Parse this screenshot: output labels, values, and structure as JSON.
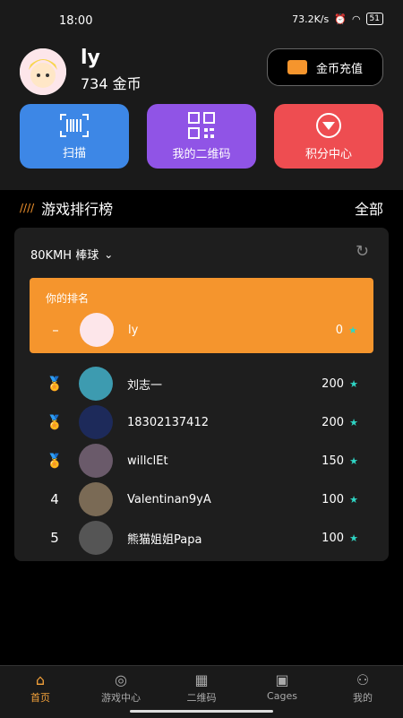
{
  "status": {
    "time": "18:00",
    "speed": "73.2K/s",
    "battery": "51"
  },
  "profile": {
    "username": "ly",
    "coins": "734 金币"
  },
  "recharge_label": "金币充值",
  "tiles": [
    {
      "label": "扫描",
      "icon": "barcode-scan-icon"
    },
    {
      "label": "我的二维码",
      "icon": "qr-code-icon"
    },
    {
      "label": "积分中心",
      "icon": "points-badge-icon"
    }
  ],
  "leaderboard": {
    "title": "游戏排行榜",
    "view_all": "全部",
    "game": "80KMH 棒球",
    "my_rank_label": "你的排名",
    "me": {
      "rank": "–",
      "name": "ly",
      "score": "0"
    },
    "rows": [
      {
        "rank": "1",
        "name": "刘志一",
        "score": "200"
      },
      {
        "rank": "2",
        "name": "18302137412",
        "score": "200"
      },
      {
        "rank": "3",
        "name": "willclEt",
        "score": "150"
      },
      {
        "rank": "4",
        "name": "Valentinan9yA",
        "score": "100"
      },
      {
        "rank": "5",
        "name": "熊猫姐姐Papa",
        "score": "100"
      }
    ]
  },
  "nav": [
    {
      "label": "首页",
      "icon": "home-icon"
    },
    {
      "label": "游戏中心",
      "icon": "gamepad-icon"
    },
    {
      "label": "二维码",
      "icon": "qr-code-icon"
    },
    {
      "label": "Cages",
      "icon": "cages-icon"
    },
    {
      "label": "我的",
      "icon": "profile-icon"
    }
  ],
  "colors": {
    "accent": "#f5952d",
    "scan": "#3d87e6",
    "qr": "#9054e6",
    "points": "#ee4d51",
    "star": "#2fd6c5"
  }
}
